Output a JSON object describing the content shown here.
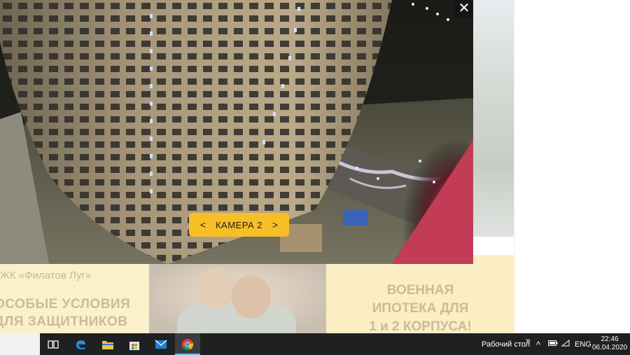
{
  "background_page": {
    "banner_caption": "ЖК «Филатов Луг»",
    "banner_headline": "ОСОБЫЕ УСЛОВИЯ\nДЛЯ ЗАЩИТНИКОВ",
    "banner_right_text": "ВОЕННАЯ\nИПОТЕКА ДЛЯ\n1 и 2 КОРПУСА!"
  },
  "modal": {
    "close_label": "✕",
    "camera_prev": "<",
    "camera_label": "КАМЕРА 2",
    "camera_next": ">"
  },
  "taskbar": {
    "icons": [
      "task-view-icon",
      "edge-icon",
      "file-explorer-icon",
      "store-icon",
      "mail-icon",
      "chrome-icon"
    ],
    "desktop_label": "Рабочий стол",
    "overflow_chevron": "»",
    "tray_up_arrow": "^",
    "language": "ENG",
    "time": "22:46",
    "date": "06.04.2020"
  },
  "colors": {
    "accent_yellow": "#f6bf26",
    "banner_bg": "#fbf0cc",
    "taskbar_bg": "#1f2022",
    "active_app_underline": "#76b9ed"
  }
}
